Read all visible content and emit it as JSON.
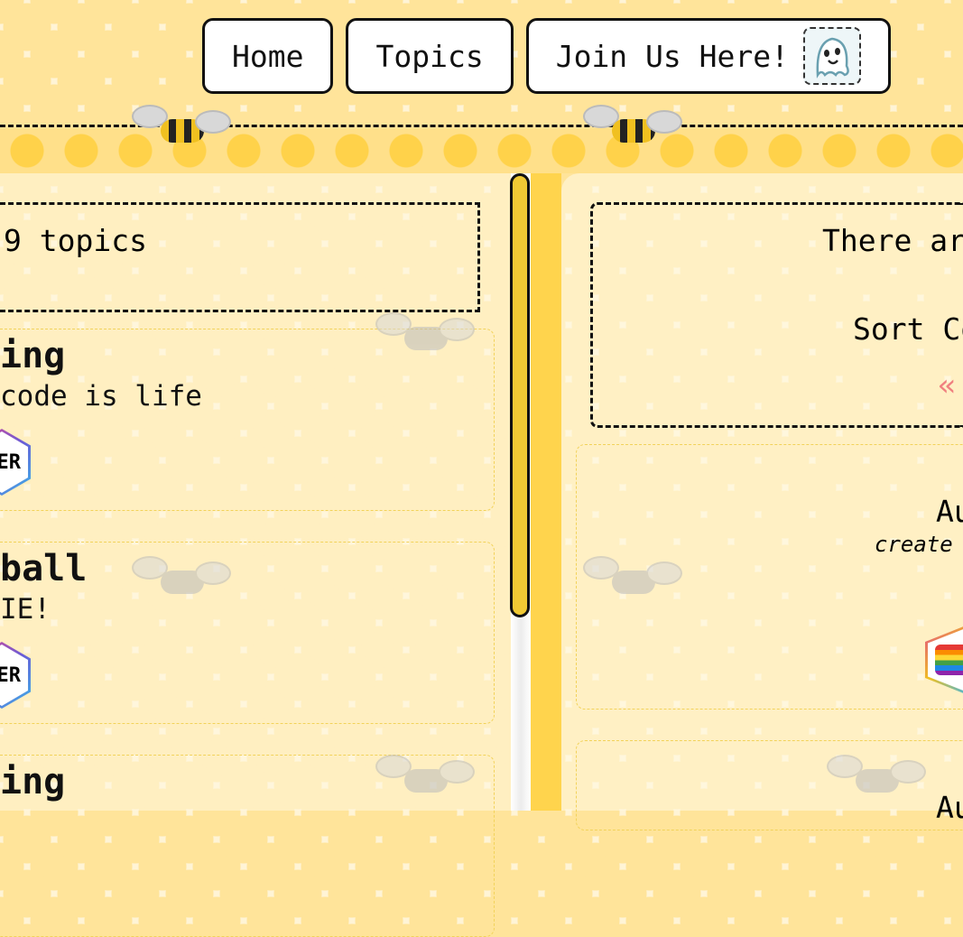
{
  "nav": {
    "home": "Home",
    "topics": "Topics",
    "join": "Join Us Here!",
    "join_icon": "ghost-icon"
  },
  "topics_panel": {
    "count_text": "9 topics",
    "cards": [
      {
        "title": "ing",
        "desc": "code is life",
        "badge": "ER"
      },
      {
        "title": "ball",
        "desc": "IE!",
        "badge": "ER"
      },
      {
        "title": "ing",
        "desc": "",
        "badge": ""
      }
    ]
  },
  "info_panel": {
    "heading": "There ar",
    "sort_label": "Sort Co",
    "chevron_icon": "chevron-left-icon"
  },
  "user_cards": [
    {
      "name": "Au",
      "meta": "create"
    },
    {
      "name": "Au",
      "meta": ""
    }
  ],
  "colors": {
    "accent": "#ffd44d",
    "thumb": "#f0c934",
    "card_border": "#f2d25a"
  }
}
